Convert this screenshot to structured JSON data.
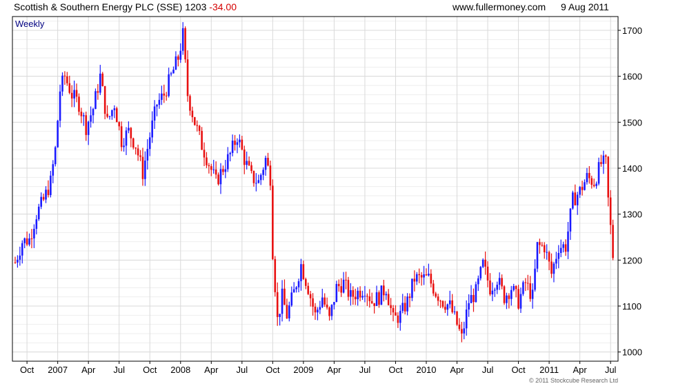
{
  "header": {
    "title": "Scottish & Southern Energy PLC (SSE)",
    "price": "1203",
    "change": "-34.00",
    "site": "www.fullermoney.com",
    "date": "9 Aug 2011"
  },
  "footer": {
    "copyright": "© 2011 Stockcube Research Ltd"
  },
  "colors": {
    "up": "#1a1aff",
    "down": "#e81010",
    "grid": "#d9d9d9",
    "label": "#000080"
  },
  "chart_data": {
    "type": "ohlc",
    "frequency": "Weekly",
    "ylim": [
      980,
      1730
    ],
    "yticks": [
      1000,
      1100,
      1200,
      1300,
      1400,
      1500,
      1600,
      1700
    ],
    "x_tick_labels": [
      "Oct",
      "2007",
      "Apr",
      "Jul",
      "Oct",
      "2008",
      "Apr",
      "Jul",
      "Oct",
      "2009",
      "Apr",
      "Jul",
      "Oct",
      "2010",
      "Apr",
      "Jul",
      "Oct",
      "2011",
      "Apr",
      "Jul"
    ],
    "x_range_weeks": 254,
    "x_tick_weeks": [
      5,
      18,
      31,
      44,
      57,
      70,
      83,
      96,
      109,
      122,
      135,
      148,
      161,
      174,
      187,
      200,
      213,
      226,
      239,
      252
    ],
    "grid": true,
    "series": [
      {
        "points": [
          [
            0,
            1195
          ],
          [
            3,
            1240
          ],
          [
            6,
            1245
          ],
          [
            9,
            1300
          ],
          [
            12,
            1330
          ],
          [
            15,
            1370
          ],
          [
            17,
            1440
          ],
          [
            19,
            1570
          ],
          [
            21,
            1600
          ],
          [
            24,
            1560
          ],
          [
            27,
            1540
          ],
          [
            30,
            1490
          ],
          [
            33,
            1530
          ],
          [
            36,
            1600
          ],
          [
            39,
            1500
          ],
          [
            42,
            1540
          ],
          [
            45,
            1460
          ],
          [
            48,
            1480
          ],
          [
            51,
            1450
          ],
          [
            54,
            1390
          ],
          [
            57,
            1470
          ],
          [
            60,
            1540
          ],
          [
            63,
            1560
          ],
          [
            66,
            1600
          ],
          [
            69,
            1640
          ],
          [
            71,
            1690
          ],
          [
            73,
            1560
          ],
          [
            76,
            1500
          ],
          [
            79,
            1450
          ],
          [
            82,
            1410
          ],
          [
            85,
            1370
          ],
          [
            88,
            1400
          ],
          [
            91,
            1430
          ],
          [
            94,
            1470
          ],
          [
            97,
            1420
          ],
          [
            100,
            1380
          ],
          [
            103,
            1370
          ],
          [
            106,
            1420
          ],
          [
            108,
            1380
          ],
          [
            109,
            1220
          ],
          [
            111,
            1070
          ],
          [
            113,
            1120
          ],
          [
            115,
            1080
          ],
          [
            118,
            1130
          ],
          [
            121,
            1190
          ],
          [
            124,
            1140
          ],
          [
            127,
            1080
          ],
          [
            130,
            1120
          ],
          [
            133,
            1070
          ],
          [
            136,
            1140
          ],
          [
            139,
            1150
          ],
          [
            142,
            1120
          ],
          [
            145,
            1130
          ],
          [
            148,
            1140
          ],
          [
            151,
            1110
          ],
          [
            154,
            1120
          ],
          [
            157,
            1140
          ],
          [
            160,
            1070
          ],
          [
            163,
            1080
          ],
          [
            166,
            1110
          ],
          [
            169,
            1160
          ],
          [
            172,
            1160
          ],
          [
            175,
            1160
          ],
          [
            178,
            1130
          ],
          [
            181,
            1110
          ],
          [
            184,
            1100
          ],
          [
            187,
            1060
          ],
          [
            189,
            1030
          ],
          [
            192,
            1110
          ],
          [
            195,
            1130
          ],
          [
            198,
            1190
          ],
          [
            201,
            1140
          ],
          [
            204,
            1160
          ],
          [
            207,
            1120
          ],
          [
            210,
            1140
          ],
          [
            213,
            1110
          ],
          [
            216,
            1150
          ],
          [
            219,
            1120
          ],
          [
            221,
            1230
          ],
          [
            224,
            1230
          ],
          [
            227,
            1170
          ],
          [
            230,
            1230
          ],
          [
            233,
            1230
          ],
          [
            236,
            1330
          ],
          [
            239,
            1350
          ],
          [
            242,
            1380
          ],
          [
            245,
            1370
          ],
          [
            248,
            1410
          ],
          [
            250,
            1410
          ],
          [
            251,
            1330
          ],
          [
            252,
            1270
          ],
          [
            253,
            1210
          ]
        ]
      }
    ]
  }
}
